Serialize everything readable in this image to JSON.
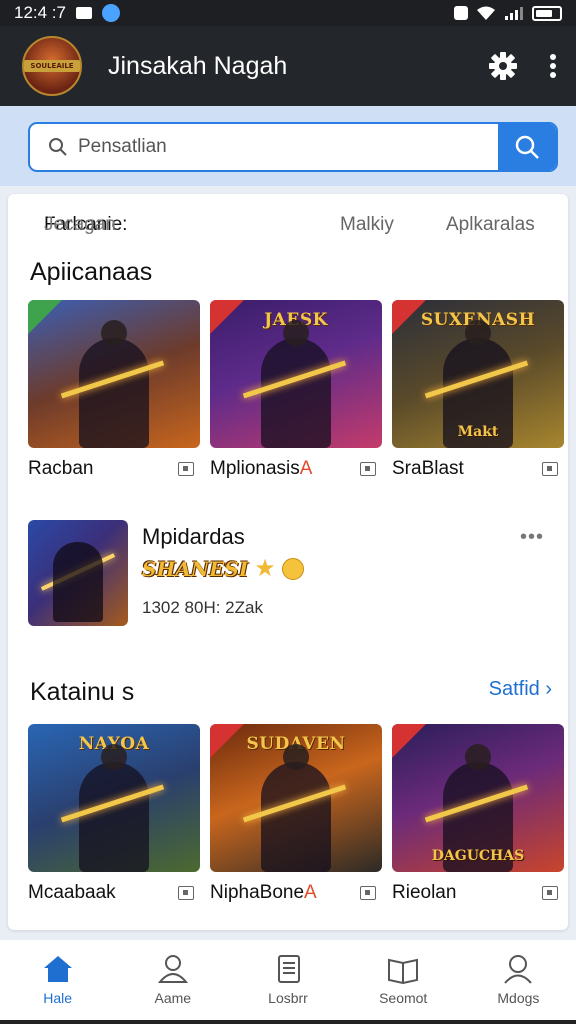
{
  "status_bar": {
    "time": "12:4 :7"
  },
  "app_bar": {
    "logo_text": "SOULEAILE",
    "title": "Jinsakah Nagah"
  },
  "search": {
    "placeholder": "Pensatlian"
  },
  "filters": {
    "main_label": "Farlcanie:",
    "main_sub": "Jecagan",
    "tab2": "Malkiy",
    "tab3": "Aplkaralas"
  },
  "section1": {
    "title": "Apiicanaas",
    "tiles": [
      {
        "name": "Racban",
        "banner": "",
        "foot": "",
        "flag": "green",
        "gradient": "linear-gradient(160deg,#3b5fb5 0%,#6d3b2b 50%,#c8661d 100%)"
      },
      {
        "name": "Mplionasis",
        "name_accent": "A",
        "banner": "JAESK",
        "foot": "",
        "flag": "red",
        "gradient": "linear-gradient(160deg,#3a1d6a 0%,#5e2b8a 45%,#c43b6b 100%)"
      },
      {
        "name": "SraBlast",
        "banner": "SUXENASH",
        "foot": "Makt",
        "flag": "red",
        "gradient": "linear-gradient(160deg,#2b2e3a 0%,#5a4a2a 50%,#a8862e 100%)"
      }
    ]
  },
  "featured": {
    "title": "Mpidardas",
    "badge": "SHANESI",
    "meta": "1302 80H: 2Zak",
    "more": "•••"
  },
  "section2": {
    "title": "Katainu s",
    "see_all": "Satfid ›",
    "tiles": [
      {
        "name": "Mcaabaak",
        "banner": "NAYOA",
        "foot": "",
        "flag": "none",
        "gradient": "linear-gradient(160deg,#2966b5 0%,#2a3f6e 50%,#4c6a2e 100%)"
      },
      {
        "name": "NiphaBone",
        "name_accent": "A",
        "banner": "SUDAVEN",
        "foot": "",
        "flag": "red",
        "gradient": "linear-gradient(160deg,#6b2a0e 0%,#c9661d 45%,#2c2a26 100%)"
      },
      {
        "name": "Rieolan",
        "banner": "",
        "foot": "DAGUCHAS",
        "flag": "red",
        "gradient": "linear-gradient(160deg,#2a1e5a 0%,#6b2a7a 45%,#c8452b 100%)"
      }
    ]
  },
  "bottom_nav": [
    {
      "label": "Hale",
      "icon": "home-icon",
      "active": true
    },
    {
      "label": "Aame",
      "icon": "person-icon",
      "active": false
    },
    {
      "label": "Losbrr",
      "icon": "document-icon",
      "active": false
    },
    {
      "label": "Seomot",
      "icon": "book-icon",
      "active": false
    },
    {
      "label": "Mdogs",
      "icon": "profile-icon",
      "active": false
    }
  ],
  "colors": {
    "accent": "#2a7de1",
    "active_nav": "#1f6fd1",
    "app_bar": "#23262b"
  }
}
